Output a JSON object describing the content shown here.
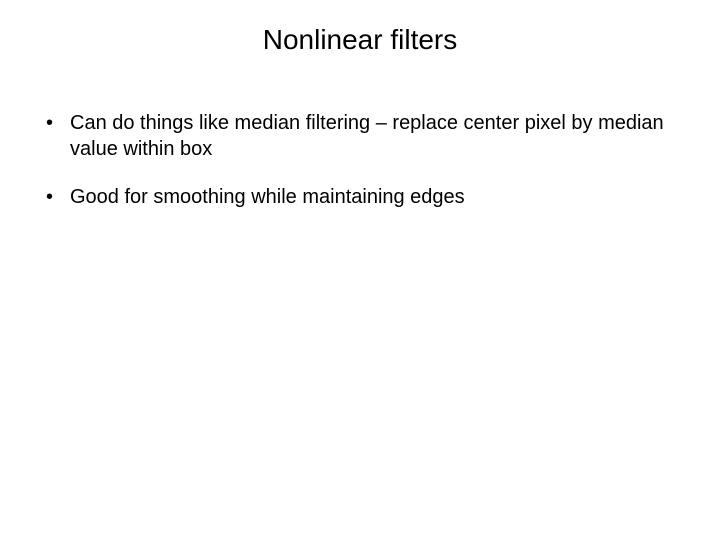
{
  "slide": {
    "title": "Nonlinear filters",
    "bullets": [
      "Can do things like median filtering – replace center pixel by median value within box",
      "Good for smoothing while maintaining edges"
    ]
  }
}
